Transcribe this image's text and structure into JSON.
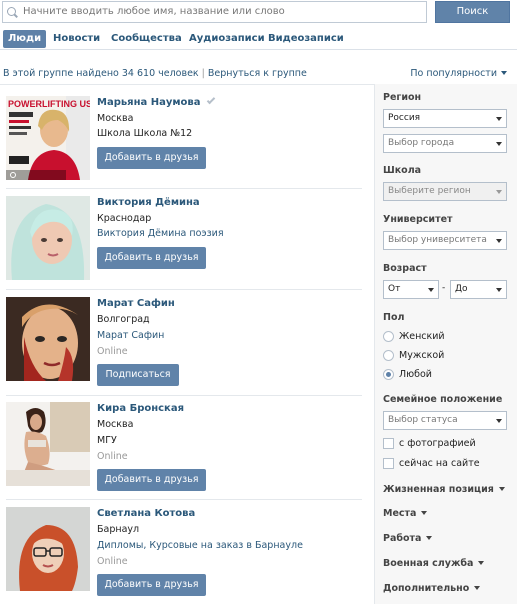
{
  "search": {
    "placeholder": "Начните вводить любое имя, название или слово",
    "button": "Поиск"
  },
  "tabs": [
    "Люди",
    "Новости",
    "Сообщества",
    "Аудиозаписи",
    "Видеозаписи"
  ],
  "summary": {
    "text": "В этой группе найдено 34 610 человек",
    "back_link": "Вернуться к группе",
    "sort": "По популярности"
  },
  "results": [
    {
      "name": "Марьяна Наумова",
      "verified": true,
      "lines": [
        "Москва",
        "Школа Школа №12"
      ],
      "button": "Добавить в друзья",
      "cover_text": "POWERLIFTING USA"
    },
    {
      "name": "Виктория Дёмина",
      "lines": [
        "Краснодар"
      ],
      "link": "Виктория Дёмина поэзия",
      "button": "Добавить в друзья"
    },
    {
      "name": "Марат Сафин",
      "lines": [
        "Волгоград"
      ],
      "link": "Марат Сафин",
      "status": "Online",
      "button": "Подписаться"
    },
    {
      "name": "Кира Бронская",
      "lines": [
        "Москва",
        "МГУ"
      ],
      "status": "Online",
      "button": "Добавить в друзья"
    },
    {
      "name": "Светлана Котова",
      "lines": [
        "Барнаул"
      ],
      "link": "Дипломы, Курсовые на заказ в Барнауле",
      "status": "Online",
      "button": "Добавить в друзья"
    }
  ],
  "sidebar": {
    "region_label": "Регион",
    "country": "Россия",
    "city": "Выбор города",
    "school_label": "Школа",
    "school": "Выберите регион",
    "university_label": "Университет",
    "university": "Выбор университета",
    "age_label": "Возраст",
    "age_from": "От",
    "age_to": "До",
    "gender_label": "Пол",
    "gender_options": [
      "Женский",
      "Мужской",
      "Любой"
    ],
    "gender_selected": "Любой",
    "family_label": "Семейное положение",
    "family": "Выбор статуса",
    "with_photo": "с фотографией",
    "online_now": "сейчас на сайте",
    "sections": [
      "Жизненная позиция",
      "Места",
      "Работа",
      "Военная служба",
      "Дополнительно"
    ]
  },
  "colors": {
    "accent": "#5e81a8",
    "link": "#2b587a"
  }
}
